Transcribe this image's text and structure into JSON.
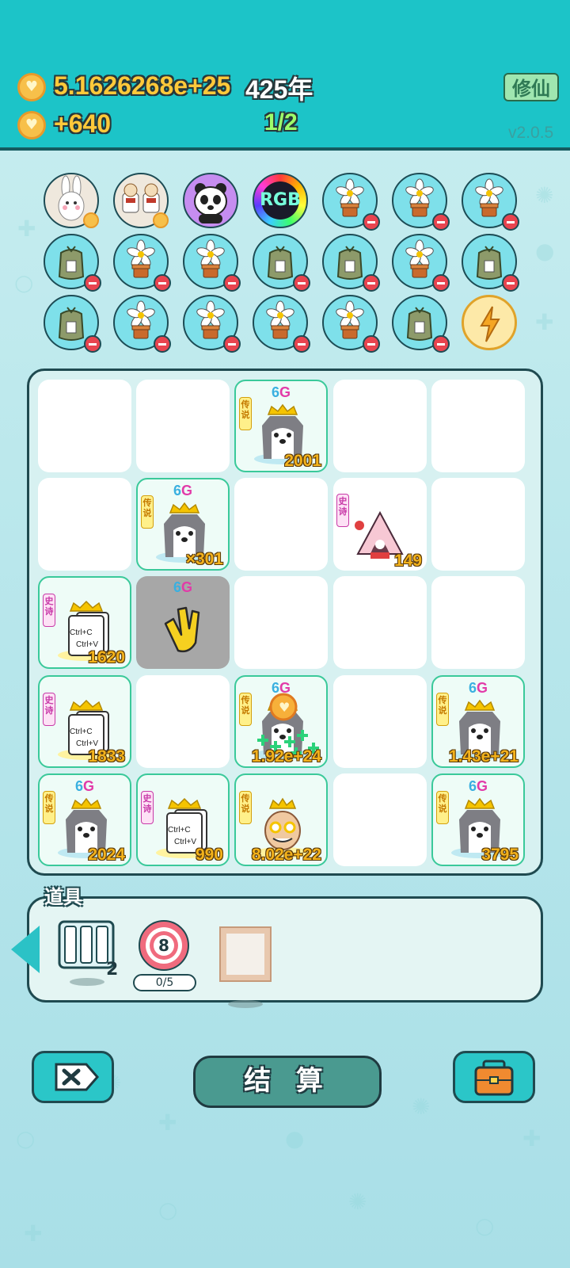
{
  "header": {
    "gold": "5.1626268e+25",
    "year": "425年",
    "income": "+640",
    "page": "1/2",
    "mode_button": "修仙",
    "version": "v2.0.5"
  },
  "buffs": [
    {
      "kind": "bunny",
      "minus": false,
      "heart": true
    },
    {
      "kind": "dairy",
      "minus": false,
      "heart": true
    },
    {
      "kind": "panda",
      "minus": false,
      "heart": false
    },
    {
      "kind": "rgb",
      "label": "RGB",
      "minus": false,
      "heart": false
    },
    {
      "kind": "flower",
      "minus": true
    },
    {
      "kind": "flower",
      "minus": true
    },
    {
      "kind": "flower",
      "minus": true
    },
    {
      "kind": "bag",
      "minus": true
    },
    {
      "kind": "flower",
      "minus": true
    },
    {
      "kind": "flower",
      "minus": true
    },
    {
      "kind": "bag",
      "minus": true
    },
    {
      "kind": "bag",
      "minus": true
    },
    {
      "kind": "flower",
      "minus": true
    },
    {
      "kind": "bag",
      "minus": true
    },
    {
      "kind": "bag",
      "minus": true
    },
    {
      "kind": "flower",
      "minus": true
    },
    {
      "kind": "flower",
      "minus": true
    },
    {
      "kind": "flower",
      "minus": true
    },
    {
      "kind": "flower",
      "minus": true
    },
    {
      "kind": "bag",
      "minus": true
    },
    {
      "kind": "lightning",
      "minus": false
    }
  ],
  "grid": {
    "tags": {
      "legend": "传说",
      "epic": "史诗"
    },
    "gen_label": {
      "num": "6",
      "letter": "G"
    },
    "cells": [
      {
        "row": 0,
        "col": 0,
        "empty": true
      },
      {
        "row": 0,
        "col": 1,
        "empty": true
      },
      {
        "row": 0,
        "col": 2,
        "item": "husky",
        "tag": "legend",
        "gen": true,
        "count": "2001"
      },
      {
        "row": 0,
        "col": 3,
        "empty": true
      },
      {
        "row": 0,
        "col": 4,
        "empty": true
      },
      {
        "row": 1,
        "col": 0,
        "empty": true
      },
      {
        "row": 1,
        "col": 1,
        "item": "husky",
        "tag": "legend",
        "gen": true,
        "count": "×301"
      },
      {
        "row": 1,
        "col": 2,
        "empty": true
      },
      {
        "row": 1,
        "col": 3,
        "item": "tent",
        "tag": "epic",
        "gen": false,
        "count": "149",
        "plain": true
      },
      {
        "row": 1,
        "col": 4,
        "empty": true
      },
      {
        "row": 2,
        "col": 0,
        "item": "ctrl",
        "tag": "epic",
        "gen": false,
        "count": "1620"
      },
      {
        "row": 2,
        "col": 1,
        "item": "hand",
        "gen": true,
        "gray": true
      },
      {
        "row": 2,
        "col": 2,
        "empty": true
      },
      {
        "row": 2,
        "col": 3,
        "empty": true
      },
      {
        "row": 2,
        "col": 4,
        "empty": true
      },
      {
        "row": 3,
        "col": 0,
        "item": "ctrl",
        "tag": "epic",
        "gen": false,
        "count": "1833"
      },
      {
        "row": 3,
        "col": 1,
        "empty": true
      },
      {
        "row": 3,
        "col": 2,
        "item": "husky",
        "tag": "legend",
        "gen": true,
        "count": "1.92e+24",
        "boost": true
      },
      {
        "row": 3,
        "col": 3,
        "empty": true
      },
      {
        "row": 3,
        "col": 4,
        "item": "husky",
        "tag": "legend",
        "gen": true,
        "count": "1.43e+21"
      },
      {
        "row": 4,
        "col": 0,
        "item": "husky",
        "tag": "legend",
        "gen": true,
        "count": "2024"
      },
      {
        "row": 4,
        "col": 1,
        "item": "ctrl",
        "tag": "epic",
        "gen": false,
        "count": "990"
      },
      {
        "row": 4,
        "col": 2,
        "item": "oldman",
        "tag": "legend",
        "gen": false,
        "count": "8.02e+22"
      },
      {
        "row": 4,
        "col": 3,
        "empty": true
      },
      {
        "row": 4,
        "col": 4,
        "item": "husky",
        "tag": "legend",
        "gen": true,
        "count": "3795"
      }
    ],
    "ctrl_lines": [
      "Ctrl+C",
      "Ctrl+V"
    ]
  },
  "props": {
    "title": "道具",
    "shelf_count": "2",
    "target_number": "8",
    "target_progress": "0/5"
  },
  "buttons": {
    "settle": "结 算"
  },
  "colors": {
    "header": "#1cc4c8",
    "accent_gold": "#ffc93a",
    "button_teal": "#2bc6c8"
  }
}
